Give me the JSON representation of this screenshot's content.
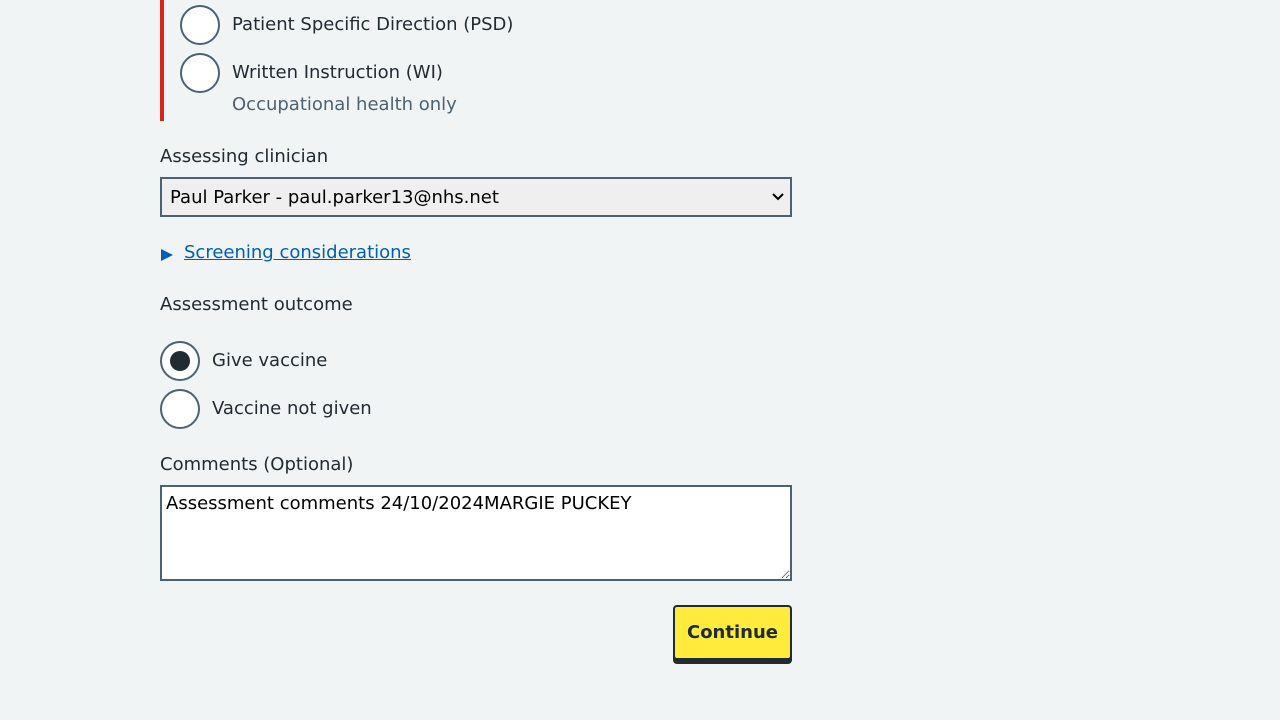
{
  "prescribing_method": {
    "options": [
      {
        "label": "Patient Specific Direction (PSD)",
        "checked": false
      },
      {
        "label": "Written Instruction (WI)",
        "hint": "Occupational health only",
        "checked": false
      }
    ],
    "error_color": "#d5281b"
  },
  "assessing_clinician": {
    "label": "Assessing clinician",
    "selected": "Paul Parker - paul.parker13@nhs.net"
  },
  "screening": {
    "link_text": "Screening considerations"
  },
  "assessment_outcome": {
    "label": "Assessment outcome",
    "options": [
      {
        "label": "Give vaccine",
        "checked": true
      },
      {
        "label": "Vaccine not given",
        "checked": false
      }
    ]
  },
  "comments": {
    "label": "Comments (Optional)",
    "value": "Assessment comments 24/10/2024MARGIE PUCKEY"
  },
  "continue_button": {
    "label": "Continue",
    "color": "#ffeb3b"
  },
  "colors": {
    "background": "#f0f4f5",
    "text": "#212b32",
    "secondary_text": "#4c6272",
    "link": "#005eb8",
    "border": "#4c6272"
  },
  "icons": {
    "select_chevron": "chevron-down-icon",
    "details_toggle": "triangle-right-icon"
  }
}
